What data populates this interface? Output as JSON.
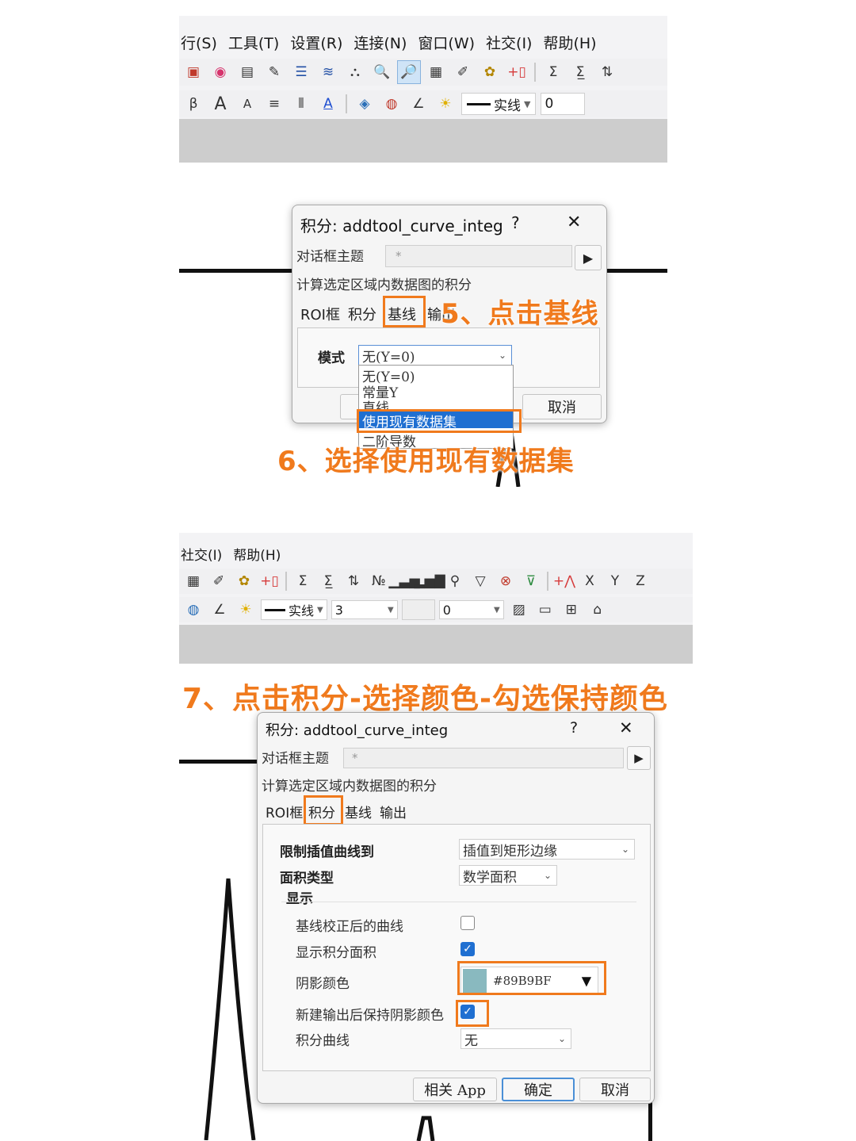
{
  "panel1": {
    "menu": [
      "行(S)",
      "工具(T)",
      "设置(R)",
      "连接(N)",
      "窗口(W)",
      "社交(I)",
      "帮助(H)"
    ],
    "line_style_label": "实线",
    "width_value": "0"
  },
  "panel2": {
    "dialog": {
      "title": "积分: addtool_curve_integ",
      "help": "?",
      "close": "✕",
      "theme_label": "对话框主题",
      "theme_value": "*",
      "description": "计算选定区域内数据图的积分",
      "tabs": [
        "ROI框",
        "积分",
        "基线",
        "输出"
      ],
      "mode_label": "模式",
      "mode_value": "无(Y=0)",
      "dropdown_options": [
        "无(Y=0)",
        "常量Y",
        "直线",
        "使用现有数据集",
        "二阶导数"
      ],
      "cancel": "取消"
    },
    "annotation_step5": "5、点击基线",
    "annotation_step6": "6、选择使用现有数据集"
  },
  "panel3": {
    "menu": [
      "社交(I)",
      "帮助(H)"
    ],
    "line_style_label": "实线",
    "width_value": "3",
    "color_value": "0",
    "annotation_step7": "7、点击积分-选择颜色-勾选保持颜色",
    "dialog": {
      "title": "积分: addtool_curve_integ",
      "help": "?",
      "close": "✕",
      "theme_label": "对话框主题",
      "theme_value": "*",
      "description": "计算选定区域内数据图的积分",
      "tabs": [
        "ROI框",
        "积分",
        "基线",
        "输出"
      ],
      "limit_label": "限制插值曲线到",
      "limit_value": "插值到矩形边缘",
      "area_type_label": "面积类型",
      "area_type_value": "数学面积",
      "display_label": "显示",
      "baseline_curve_label": "基线校正后的曲线",
      "baseline_curve_checked": false,
      "show_area_label": "显示积分面积",
      "show_area_checked": true,
      "shade_color_label": "阴影颜色",
      "shade_color_value": "#89B9BF",
      "shade_color_swatch": "#89B9BF",
      "keep_color_label": "新建输出后保持阴影颜色",
      "keep_color_checked": true,
      "integ_curve_label": "积分曲线",
      "integ_curve_value": "无",
      "related_app": "相关 App",
      "ok": "确定",
      "cancel": "取消"
    }
  },
  "colors": {
    "accent_orange": "#F07A1D",
    "selection_blue": "#1F6FD1"
  }
}
